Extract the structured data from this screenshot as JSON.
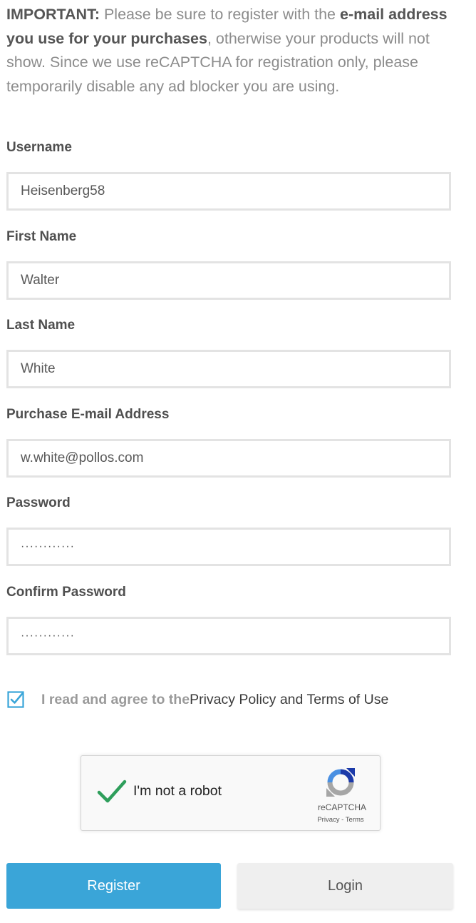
{
  "notice": {
    "important": "IMPORTANT:",
    "text_1": " Please be sure to register with the ",
    "emphasis": "e-mail address you use for your purchases",
    "text_2": ", otherwise your products will not show. Since we use reCAPTCHA for registration only, please temporarily disable any ad blocker you are using."
  },
  "form": {
    "username": {
      "label": "Username",
      "value": "Heisenberg58"
    },
    "first_name": {
      "label": "First Name",
      "value": "Walter"
    },
    "last_name": {
      "label": "Last Name",
      "value": "White"
    },
    "email": {
      "label": "Purchase E-mail Address",
      "value": "w.white@pollos.com"
    },
    "password": {
      "label": "Password",
      "value": "············"
    },
    "confirm_password": {
      "label": "Confirm Password",
      "value": "············"
    }
  },
  "agreement": {
    "checked": true,
    "text": "I read and agree to the ",
    "link": "Privacy Policy and Terms of Use"
  },
  "captcha": {
    "checked": true,
    "label": "I'm not a robot",
    "brand": "reCAPTCHA",
    "privacy": "Privacy",
    "separator": " - ",
    "terms": "Terms"
  },
  "buttons": {
    "register": "Register",
    "login": "Login"
  },
  "colors": {
    "accent": "#3aa5d8",
    "checkmark": "#2e9e5b"
  }
}
